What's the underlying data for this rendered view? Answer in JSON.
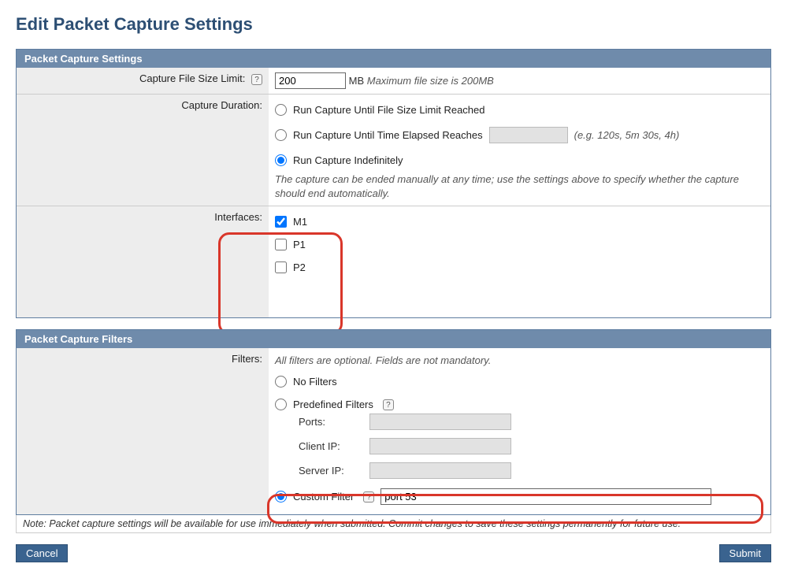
{
  "page": {
    "title": "Edit Packet Capture Settings"
  },
  "settings_panel": {
    "header": "Packet Capture Settings",
    "file_size": {
      "label": "Capture File Size Limit:",
      "value": "200",
      "unit": "MB",
      "hint": "Maximum file size is 200MB"
    },
    "duration": {
      "label": "Capture Duration:",
      "opt_size": "Run Capture Until File Size Limit Reached",
      "opt_time": "Run Capture Until Time Elapsed Reaches",
      "time_value": "",
      "time_hint": "(e.g. 120s, 5m 30s, 4h)",
      "opt_indef": "Run Capture Indefinitely",
      "note": "The capture can be ended manually at any time; use the settings above to specify whether the capture should end automatically.",
      "selected": "indef"
    },
    "interfaces": {
      "label": "Interfaces:",
      "items": [
        {
          "name": "M1",
          "checked": true
        },
        {
          "name": "P1",
          "checked": false
        },
        {
          "name": "P2",
          "checked": false
        }
      ]
    }
  },
  "filters_panel": {
    "header": "Packet Capture Filters",
    "label": "Filters:",
    "note": "All filters are optional. Fields are not mandatory.",
    "opt_none": "No Filters",
    "opt_predef": "Predefined Filters",
    "predef": {
      "ports_label": "Ports:",
      "ports_value": "",
      "client_label": "Client IP:",
      "client_value": "",
      "server_label": "Server IP:",
      "server_value": ""
    },
    "opt_custom": "Custom Filter",
    "custom_value": "port 53",
    "selected": "custom"
  },
  "footer": {
    "note": "Note: Packet capture settings will be available for use immediately when submitted. Commit changes to save these settings permanently for future use.",
    "cancel": "Cancel",
    "submit": "Submit"
  }
}
